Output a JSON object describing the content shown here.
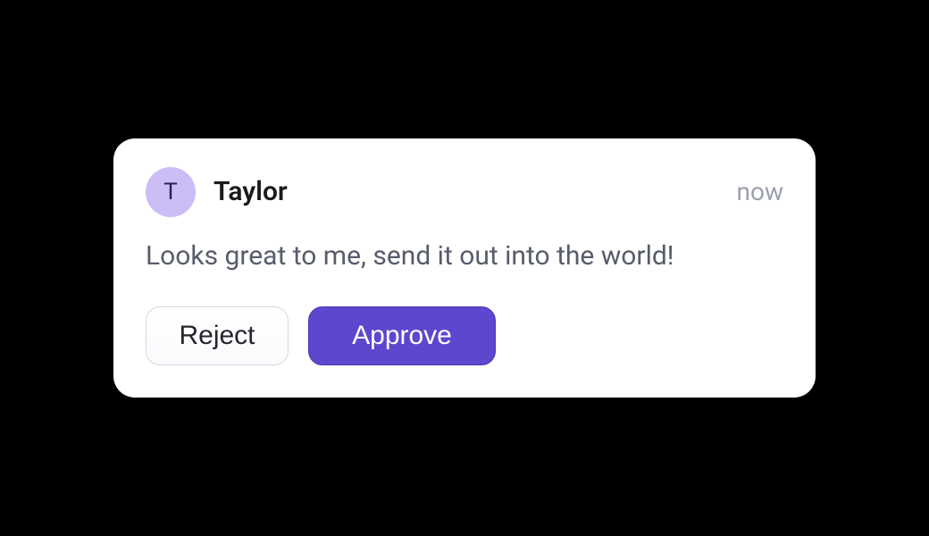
{
  "notification": {
    "author": {
      "initial": "T",
      "name": "Taylor"
    },
    "timestamp": "now",
    "message": "Looks great to me, send it out into the world!",
    "actions": {
      "reject_label": "Reject",
      "approve_label": "Approve"
    }
  },
  "colors": {
    "avatar_bg": "#cdbdf7",
    "approve_bg": "#5c47cf"
  }
}
